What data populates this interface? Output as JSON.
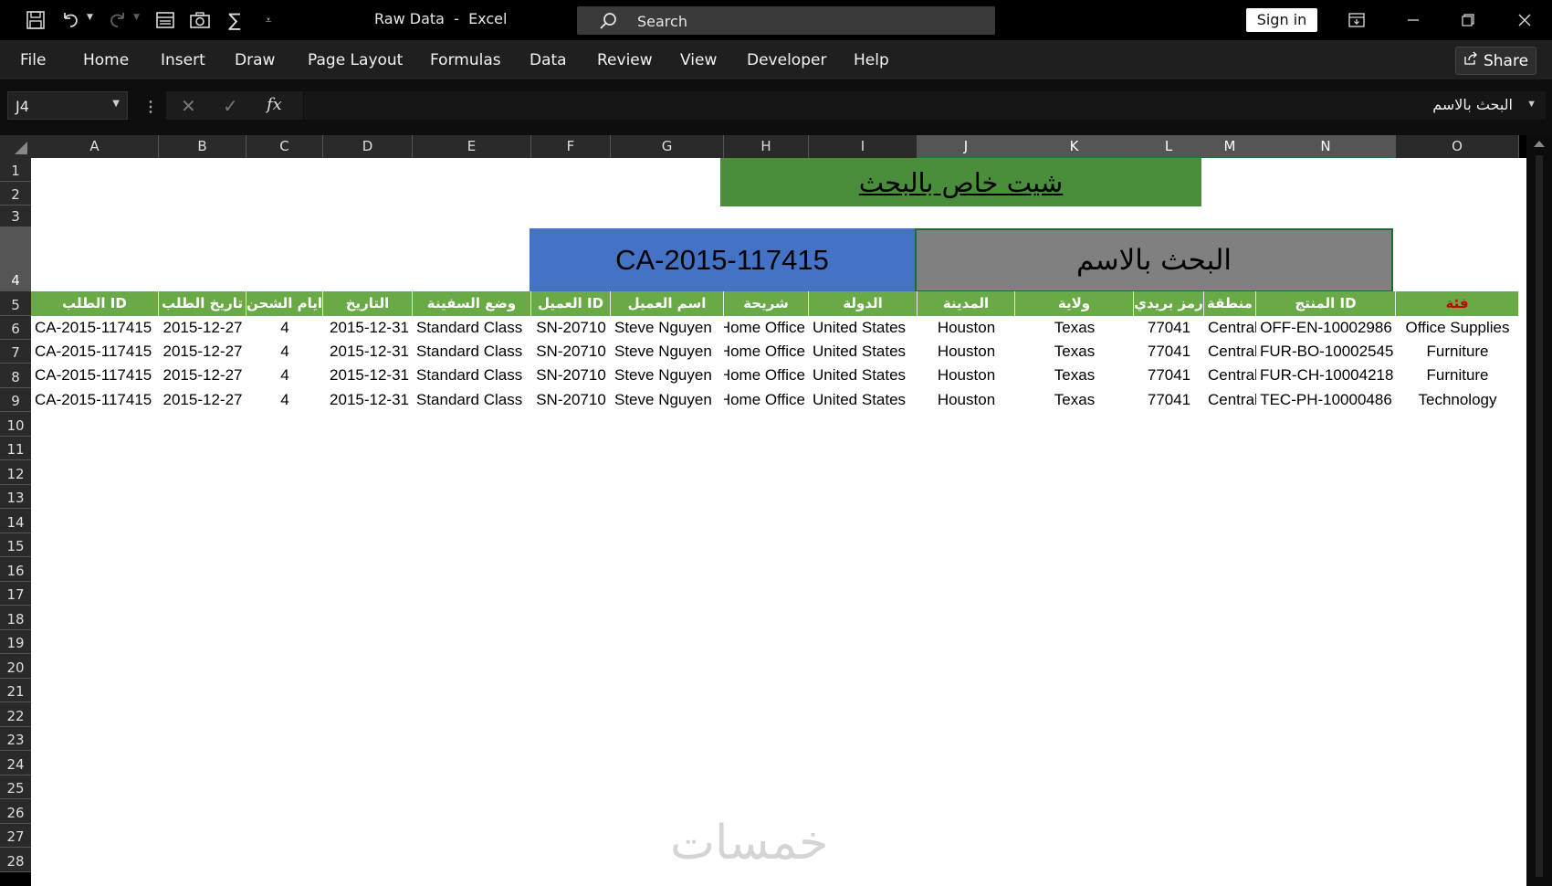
{
  "title_bar": {
    "document_title": "Raw Data  -  Excel",
    "search_label": "Search",
    "sign_in_label": "Sign in"
  },
  "menu": {
    "items": [
      "File",
      "Home",
      "Insert",
      "Draw",
      "Page Layout",
      "Formulas",
      "Data",
      "Review",
      "View",
      "Developer",
      "Help"
    ],
    "share_label": "Share"
  },
  "formula_bar": {
    "name_box": "J4",
    "fx_label": "fx",
    "formula": "البحث بالاسم"
  },
  "grid": {
    "columns": [
      "A",
      "B",
      "C",
      "D",
      "E",
      "F",
      "G",
      "H",
      "I",
      "J",
      "K",
      "L",
      "M",
      "N",
      "O"
    ],
    "selected_columns": [
      "J",
      "K",
      "L",
      "M",
      "N"
    ],
    "rows": [
      "1",
      "2",
      "3",
      "4",
      "5",
      "6",
      "7",
      "8",
      "9",
      "10",
      "11",
      "12",
      "13",
      "14",
      "15",
      "16",
      "17",
      "18",
      "19",
      "20",
      "21",
      "22",
      "23",
      "24",
      "25",
      "26",
      "27",
      "28"
    ],
    "selected_row": "4"
  },
  "sheet": {
    "title_banner": "شيت خاص بالبحث",
    "search_value": "CA-2015-117415",
    "search_label": "البحث بالاسم",
    "headers": [
      "ID الطلب",
      "تاريخ الطلب",
      "ايام الشحن",
      "التاريخ",
      "وضع السفينة",
      "ID العميل",
      "اسم العميل",
      "شريحة",
      "الدولة",
      "المدينة",
      "ولاية",
      "رمز بريدي",
      "منطقة",
      "ID المنتج",
      "فئة"
    ],
    "rows": [
      [
        "CA-2015-117415",
        "2015-12-27",
        "4",
        "2015-12-31",
        "Standard Class",
        "SN-20710",
        "Steve Nguyen",
        "Home Office",
        "United States",
        "Houston",
        "Texas",
        "77041",
        "Central",
        "OFF-EN-10002986",
        "Office Supplies"
      ],
      [
        "CA-2015-117415",
        "2015-12-27",
        "4",
        "2015-12-31",
        "Standard Class",
        "SN-20710",
        "Steve Nguyen",
        "Home Office",
        "United States",
        "Houston",
        "Texas",
        "77041",
        "Central",
        "FUR-BO-10002545",
        "Furniture"
      ],
      [
        "CA-2015-117415",
        "2015-12-27",
        "4",
        "2015-12-31",
        "Standard Class",
        "SN-20710",
        "Steve Nguyen",
        "Home Office",
        "United States",
        "Houston",
        "Texas",
        "77041",
        "Central",
        "FUR-CH-10004218",
        "Furniture"
      ],
      [
        "CA-2015-117415",
        "2015-12-27",
        "4",
        "2015-12-31",
        "Standard Class",
        "SN-20710",
        "Steve Nguyen",
        "Home Office",
        "United States",
        "Houston",
        "Texas",
        "77041",
        "Central",
        "TEC-PH-10000486",
        "Technology"
      ]
    ]
  },
  "watermark": "خمسات",
  "colors": {
    "header_green": "#6aaa46",
    "banner_green": "#4a8d3b",
    "search_blue": "#4472c4",
    "search_gray": "#808080",
    "category_red": "#c00000"
  }
}
